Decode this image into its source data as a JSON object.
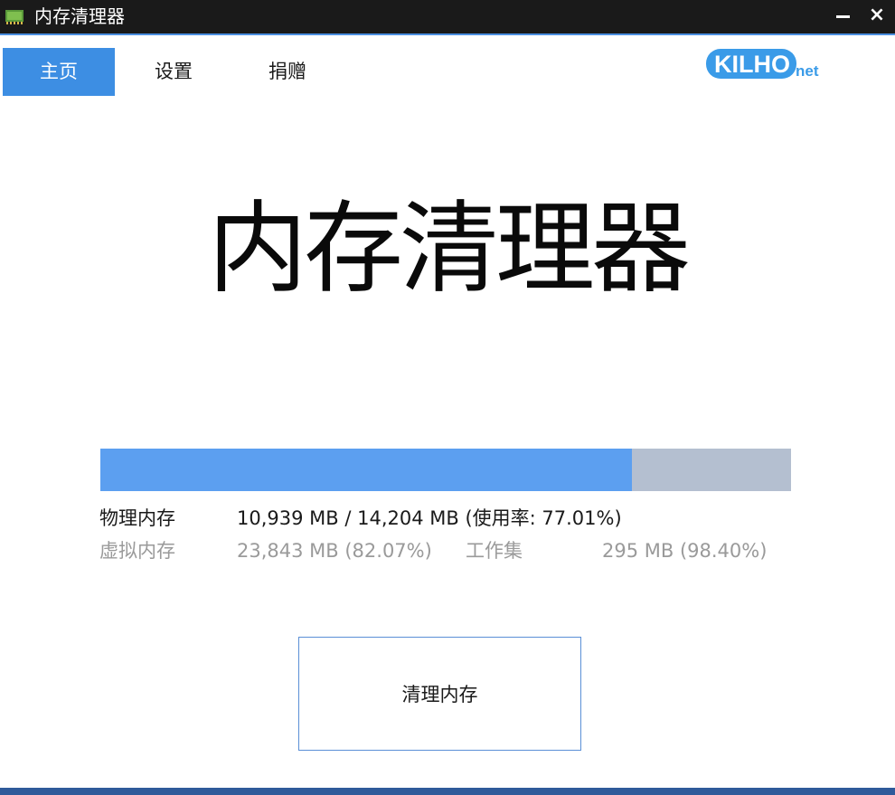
{
  "window": {
    "title": "内存清理器",
    "minimize_icon": "minimize-icon",
    "close_label": "×",
    "titlebar_color": "#1a1a1a",
    "accent_color": "#3d8ee3"
  },
  "tabs": [
    {
      "label": "主页",
      "active": true
    },
    {
      "label": "设置",
      "active": false
    },
    {
      "label": "捐赠",
      "active": false
    }
  ],
  "logo": {
    "text": "KILHO",
    "suffix": "net",
    "color": "#3a9be8"
  },
  "main": {
    "heading": "内存清理器"
  },
  "memory": {
    "usage_fraction": 0.7701,
    "bar_fill_color": "#5c9ff0",
    "bar_track_color": "#b4bfd0",
    "physical_label": "物理内存",
    "physical_value": "10,939 MB / 14,204 MB (使用率: 77.01%)",
    "virtual_label": "虚拟内存",
    "virtual_value": "23,843 MB (82.07%)",
    "working_set_label": "工作集",
    "working_set_value": "295 MB (98.40%)"
  },
  "actions": {
    "clean_label": "清理内存"
  }
}
